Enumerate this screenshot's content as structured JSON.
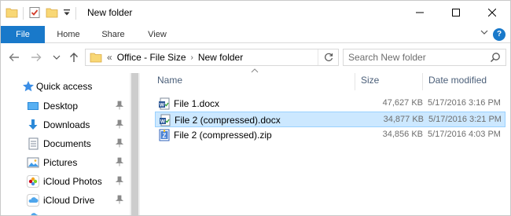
{
  "window": {
    "title": "New folder"
  },
  "ribbon": {
    "tabs": [
      {
        "label": "File"
      },
      {
        "label": "Home"
      },
      {
        "label": "Share"
      },
      {
        "label": "View"
      }
    ],
    "help_label": "?"
  },
  "address": {
    "overflow": "«",
    "crumbs": [
      "Office - File Size",
      "New folder"
    ]
  },
  "search": {
    "placeholder": "Search New folder"
  },
  "sidebar": {
    "items": [
      {
        "label": "Quick access",
        "icon": "star-icon"
      },
      {
        "label": "Desktop",
        "icon": "desktop-icon"
      },
      {
        "label": "Downloads",
        "icon": "download-icon"
      },
      {
        "label": "Documents",
        "icon": "documents-icon"
      },
      {
        "label": "Pictures",
        "icon": "pictures-icon"
      },
      {
        "label": "iCloud Photos",
        "icon": "icloud-photos-icon"
      },
      {
        "label": "iCloud Drive",
        "icon": "icloud-drive-icon"
      }
    ]
  },
  "columns": {
    "name": "Name",
    "size": "Size",
    "date": "Date modified"
  },
  "files": [
    {
      "name": "File 1.docx",
      "size": "47,627 KB",
      "date": "5/17/2016 3:16 PM",
      "selected": false,
      "icon": "word-doc-icon"
    },
    {
      "name": "File 2 (compressed).docx",
      "size": "34,877 KB",
      "date": "5/17/2016 3:21 PM",
      "selected": true,
      "icon": "word-doc-icon"
    },
    {
      "name": "File 2 (compressed).zip",
      "size": "34,856 KB",
      "date": "5/17/2016 4:03 PM",
      "selected": false,
      "icon": "zip-archive-icon"
    }
  ],
  "colors": {
    "accent": "#1979ca",
    "selection": "#cce8ff",
    "selection_border": "#99d1ff",
    "header_text": "#4c607a"
  }
}
